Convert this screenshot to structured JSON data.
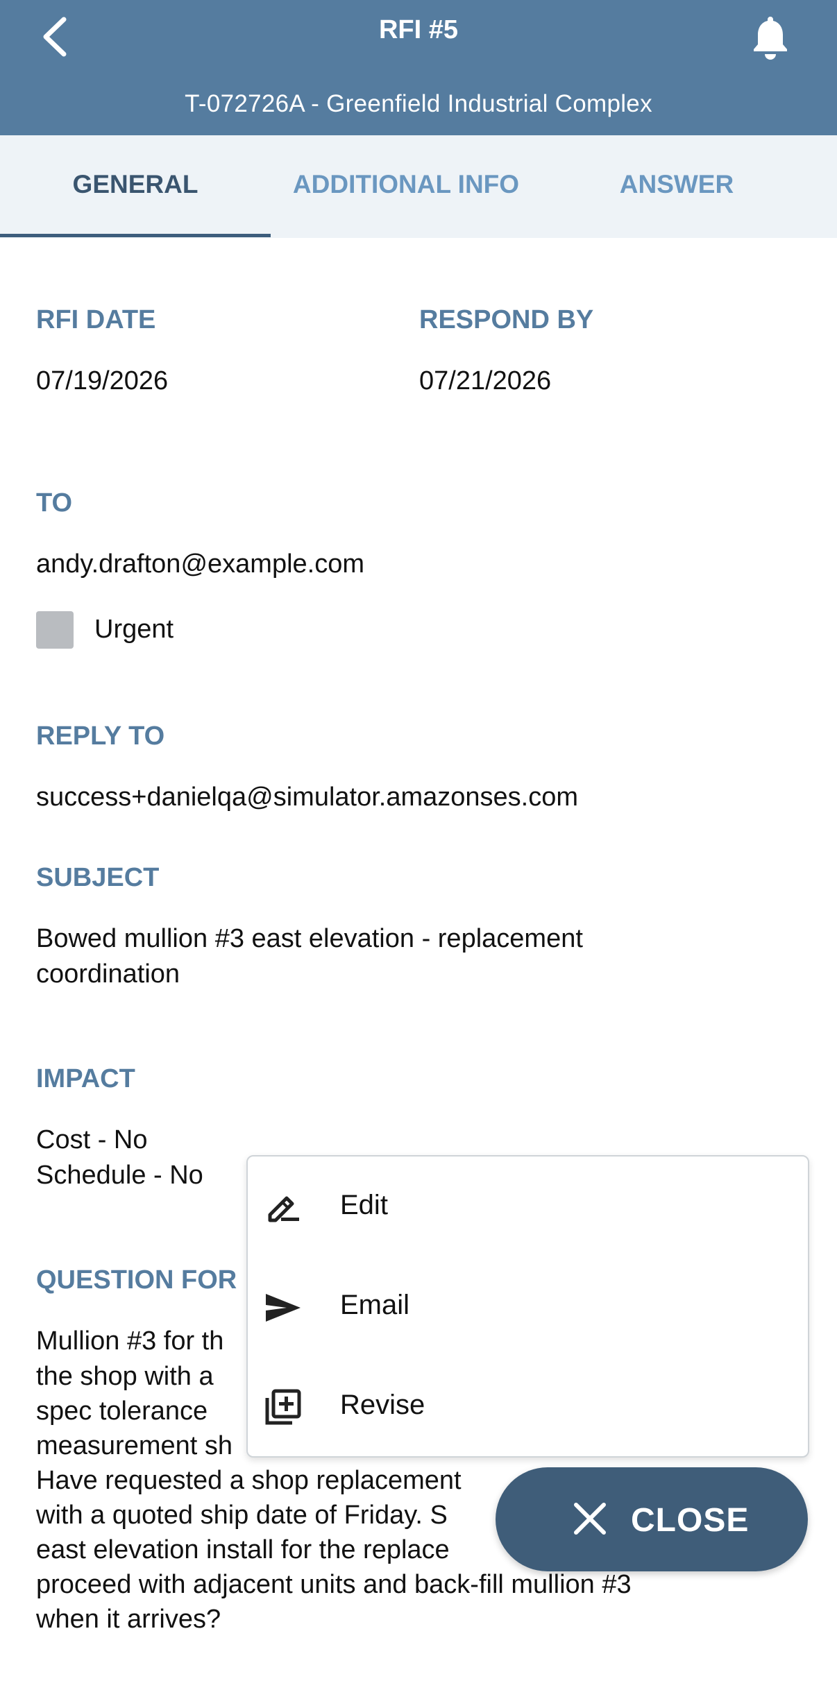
{
  "header": {
    "title": "RFI #5",
    "subtitle": "T-072726A - Greenfield Industrial Complex",
    "back_icon": "chevron-left-icon",
    "notification_icon": "bell-icon"
  },
  "tabs": [
    {
      "label": "GENERAL",
      "active": true
    },
    {
      "label": "ADDITIONAL INFO",
      "active": false
    },
    {
      "label": "ANSWER",
      "active": false
    }
  ],
  "fields": {
    "rfi_date": {
      "label": "RFI DATE",
      "value": "07/19/2026"
    },
    "respond_by": {
      "label": "RESPOND BY",
      "value": "07/21/2026"
    },
    "to": {
      "label": "TO",
      "value": "andy.drafton@example.com"
    },
    "urgent": {
      "label": "Urgent",
      "checked": false
    },
    "reply_to": {
      "label": "REPLY TO",
      "value": "success+danielqa@simulator.amazonses.com"
    },
    "subject": {
      "label": "SUBJECT",
      "line1": "Bowed mullion #3 east elevation - replacement",
      "line2": "coordination"
    },
    "impact": {
      "label": "IMPACT",
      "cost": "Cost - No",
      "schedule": "Schedule - No"
    },
    "question": {
      "label": "QUESTION FOR",
      "lines": [
        "Mullion #3 for th",
        "the shop with a",
        "spec tolerance",
        "measurement sh",
        "Have requested a shop replacement",
        "with a quoted ship date of Friday. S",
        "east elevation install for the replace",
        "proceed with adjacent units and back-fill mullion #3",
        "when it arrives?"
      ]
    }
  },
  "menu": {
    "items": [
      {
        "label": "Edit",
        "icon": "edit-icon"
      },
      {
        "label": "Email",
        "icon": "send-icon"
      },
      {
        "label": "Revise",
        "icon": "library-add-icon"
      }
    ]
  },
  "close_button": {
    "label": "CLOSE",
    "icon": "close-icon"
  },
  "colors": {
    "header_bg": "#557c9f",
    "tabs_bg": "#eef3f7",
    "label": "#557c9f",
    "fab_bg": "#3f5d79"
  }
}
